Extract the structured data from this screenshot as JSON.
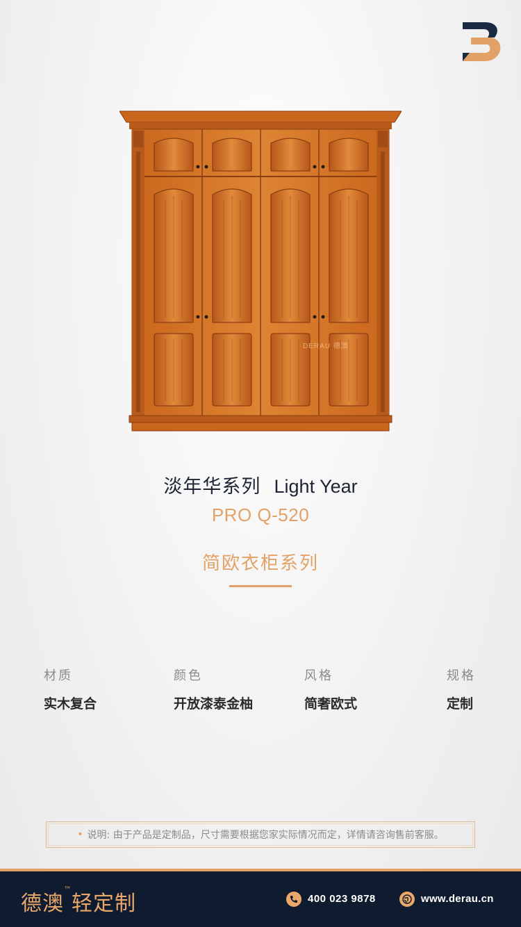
{
  "brand_logo": {
    "icon": "derau-b-logo",
    "colors": {
      "dark": "#1b2a43",
      "accent": "#e2a267"
    }
  },
  "product": {
    "image_watermark": "DERAU 德澳",
    "title_cn": "淡年华系列",
    "title_en": "Light Year",
    "model": "PRO Q-520",
    "series": "简欧衣柜系列"
  },
  "specs": [
    {
      "label": "材质",
      "value": "实木复合"
    },
    {
      "label": "颜色",
      "value": "开放漆泰金柚"
    },
    {
      "label": "风格",
      "value": "简奢欧式"
    },
    {
      "label": "规格",
      "value": "定制"
    }
  ],
  "note": {
    "bullet": "•",
    "text": "说明: 由于产品是定制品，尺寸需要根据您家实际情况而定，详情请咨询售前客服。"
  },
  "footer": {
    "brand": "德澳",
    "tm": "™",
    "brand_sub": "轻定制",
    "phone": "400 023 9878",
    "website": "www.derau.cn",
    "icons": [
      "phone-icon",
      "globe-icon"
    ],
    "colors": {
      "background": "#0f1b2e",
      "accent": "#e9a86a"
    }
  }
}
